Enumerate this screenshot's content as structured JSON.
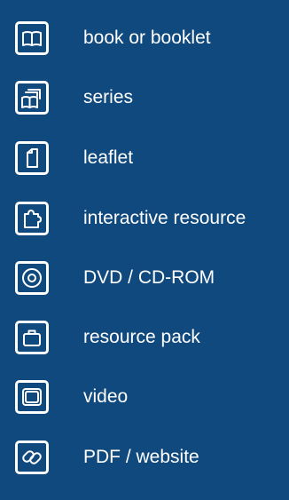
{
  "colors": {
    "background": "#10497e",
    "foreground": "#ffffff"
  },
  "items": [
    {
      "icon": "book-icon",
      "label": "book or booklet"
    },
    {
      "icon": "series-icon",
      "label": "series"
    },
    {
      "icon": "leaflet-icon",
      "label": "leaflet"
    },
    {
      "icon": "puzzle-icon",
      "label": "interactive resource"
    },
    {
      "icon": "disc-icon",
      "label": "DVD / CD-ROM"
    },
    {
      "icon": "briefcase-icon",
      "label": "resource pack"
    },
    {
      "icon": "screen-icon",
      "label": "video"
    },
    {
      "icon": "link-icon",
      "label": "PDF / website"
    }
  ]
}
